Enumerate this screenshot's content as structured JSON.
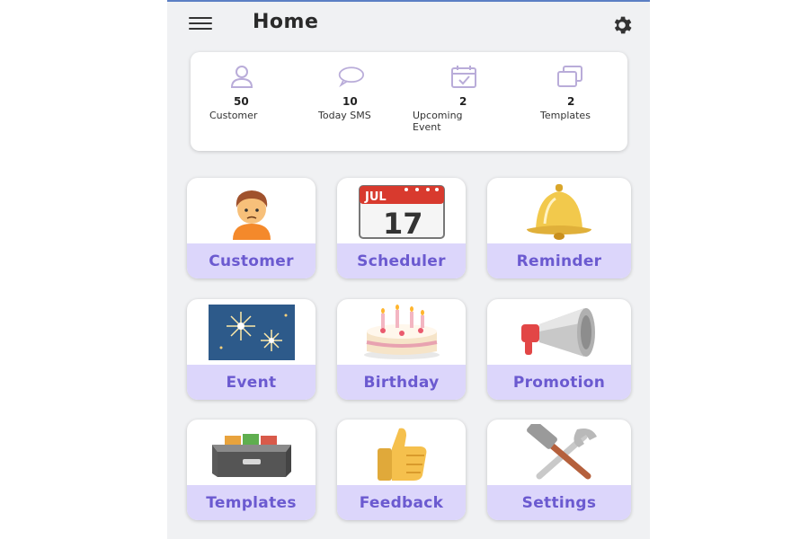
{
  "header": {
    "title": "Home",
    "menu_icon": "hamburger-icon",
    "settings_icon": "gear-icon"
  },
  "stats": [
    {
      "icon": "person-icon",
      "value": "50",
      "label": "Customer"
    },
    {
      "icon": "chat-bubble-icon",
      "value": "10",
      "label": "Today SMS"
    },
    {
      "icon": "calendar-check-icon",
      "value": "2",
      "label": "Upcoming Event"
    },
    {
      "icon": "copy-icon",
      "value": "2",
      "label": "Templates"
    }
  ],
  "tiles": [
    {
      "label": "Customer",
      "icon": "person-pouting-icon"
    },
    {
      "label": "Scheduler",
      "icon": "calendar-icon",
      "calendar_month": "JUL",
      "calendar_day": "17"
    },
    {
      "label": "Reminder",
      "icon": "bell-icon"
    },
    {
      "label": "Event",
      "icon": "fireworks-icon"
    },
    {
      "label": "Birthday",
      "icon": "birthday-cake-icon"
    },
    {
      "label": "Promotion",
      "icon": "megaphone-icon"
    },
    {
      "label": "Templates",
      "icon": "card-file-box-icon"
    },
    {
      "label": "Feedback",
      "icon": "thumbs-up-icon"
    },
    {
      "label": "Settings",
      "icon": "hammer-and-wrench-icon"
    }
  ],
  "colors": {
    "accent": "#6b5ad0",
    "caption_bg": "#dcd6fb",
    "stat_icon": "#b9acd9",
    "background": "#f0f1f3"
  }
}
